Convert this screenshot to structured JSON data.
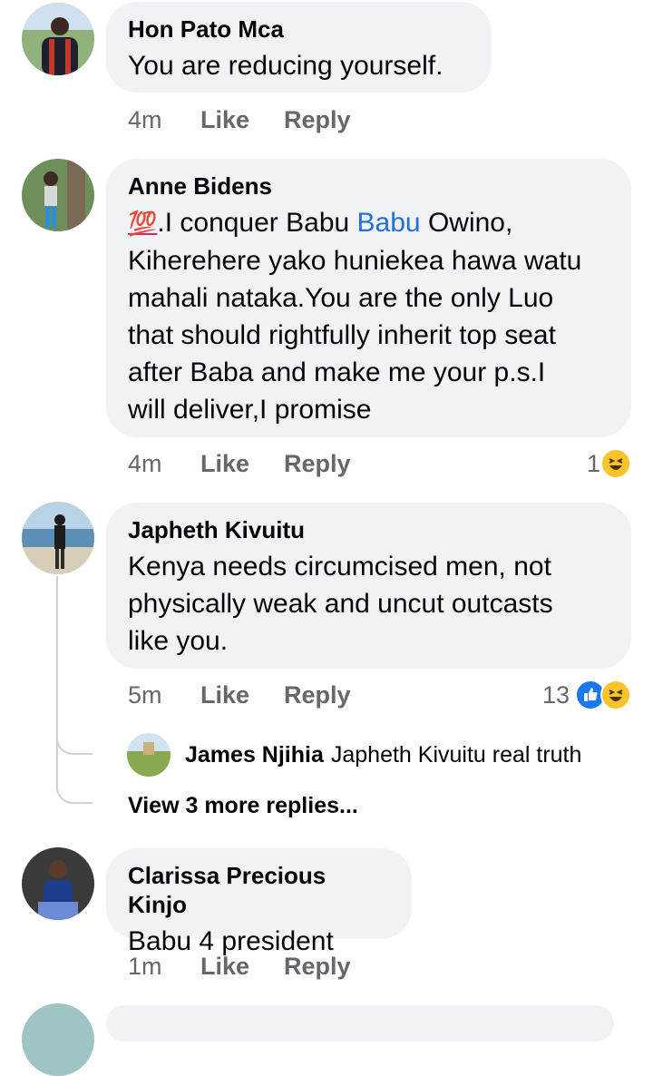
{
  "comments": [
    {
      "author": "Hon Pato Mca",
      "text": "You are reducing yourself.",
      "time": "4m",
      "like": "Like",
      "reply": "Reply"
    },
    {
      "author": "Anne Bidens",
      "emoji": "💯",
      "text_part1": ".I conquer Babu ",
      "mention": "Babu",
      "text_part2": " Owino,",
      "lines": [
        "Kiherehere yako huniekea hawa watu",
        "mahali nataka.You are the only Luo",
        "that should rightfully inherit top seat",
        "after Baba and make me your p.s.I",
        "will deliver,I promise"
      ],
      "time": "4m",
      "like": "Like",
      "reply": "Reply",
      "reaction_count": "1",
      "reaction_icons": [
        "haha-icon"
      ]
    },
    {
      "author": "Japheth Kivuitu",
      "lines": [
        "Kenya needs  circumcised men, not",
        "physically weak and uncut outcasts",
        "like you."
      ],
      "time": "5m",
      "like": "Like",
      "reply": "Reply",
      "reaction_count": "13",
      "reaction_icons": [
        "like-icon",
        "haha-icon"
      ],
      "reply_preview": {
        "author": "James Njihia",
        "text": "Japheth Kivuitu  real truth"
      },
      "view_more": "View 3 more replies..."
    },
    {
      "author": "Clarissa Precious Kinjo",
      "text": "Babu 4 president",
      "time": "1m",
      "like": "Like",
      "reply": "Reply"
    }
  ],
  "colors": {
    "bubble": "#f0f2f5",
    "meta": "#65676b",
    "mention": "#216fdb",
    "like": "#1877f2",
    "haha": "#f7c42e"
  }
}
